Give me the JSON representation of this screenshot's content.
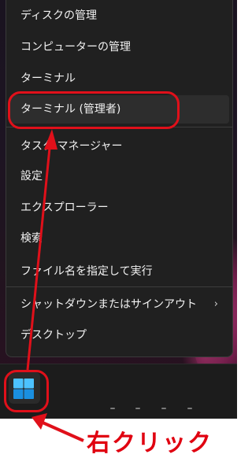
{
  "context_menu": {
    "items": [
      {
        "label": "ディスクの管理"
      },
      {
        "label": "コンピューターの管理"
      },
      {
        "label": "ターミナル"
      },
      {
        "label": "ターミナル (管理者)"
      },
      {
        "label": "タスク マネージャー"
      },
      {
        "label": "設定"
      },
      {
        "label": "エクスプローラー"
      },
      {
        "label": "検索"
      },
      {
        "label": "ファイル名を指定して実行"
      },
      {
        "label": "シャットダウンまたはサインアウト",
        "submenu_icon": "chevron-right-icon"
      },
      {
        "label": "デスクトップ"
      }
    ],
    "highlighted_item": "ターミナル (管理者)",
    "chevron_glyph": "›"
  },
  "taskbar": {
    "start_button_icon": "windows-logo-icon"
  },
  "annotation": {
    "text": "右クリック",
    "color": "#e00010"
  }
}
